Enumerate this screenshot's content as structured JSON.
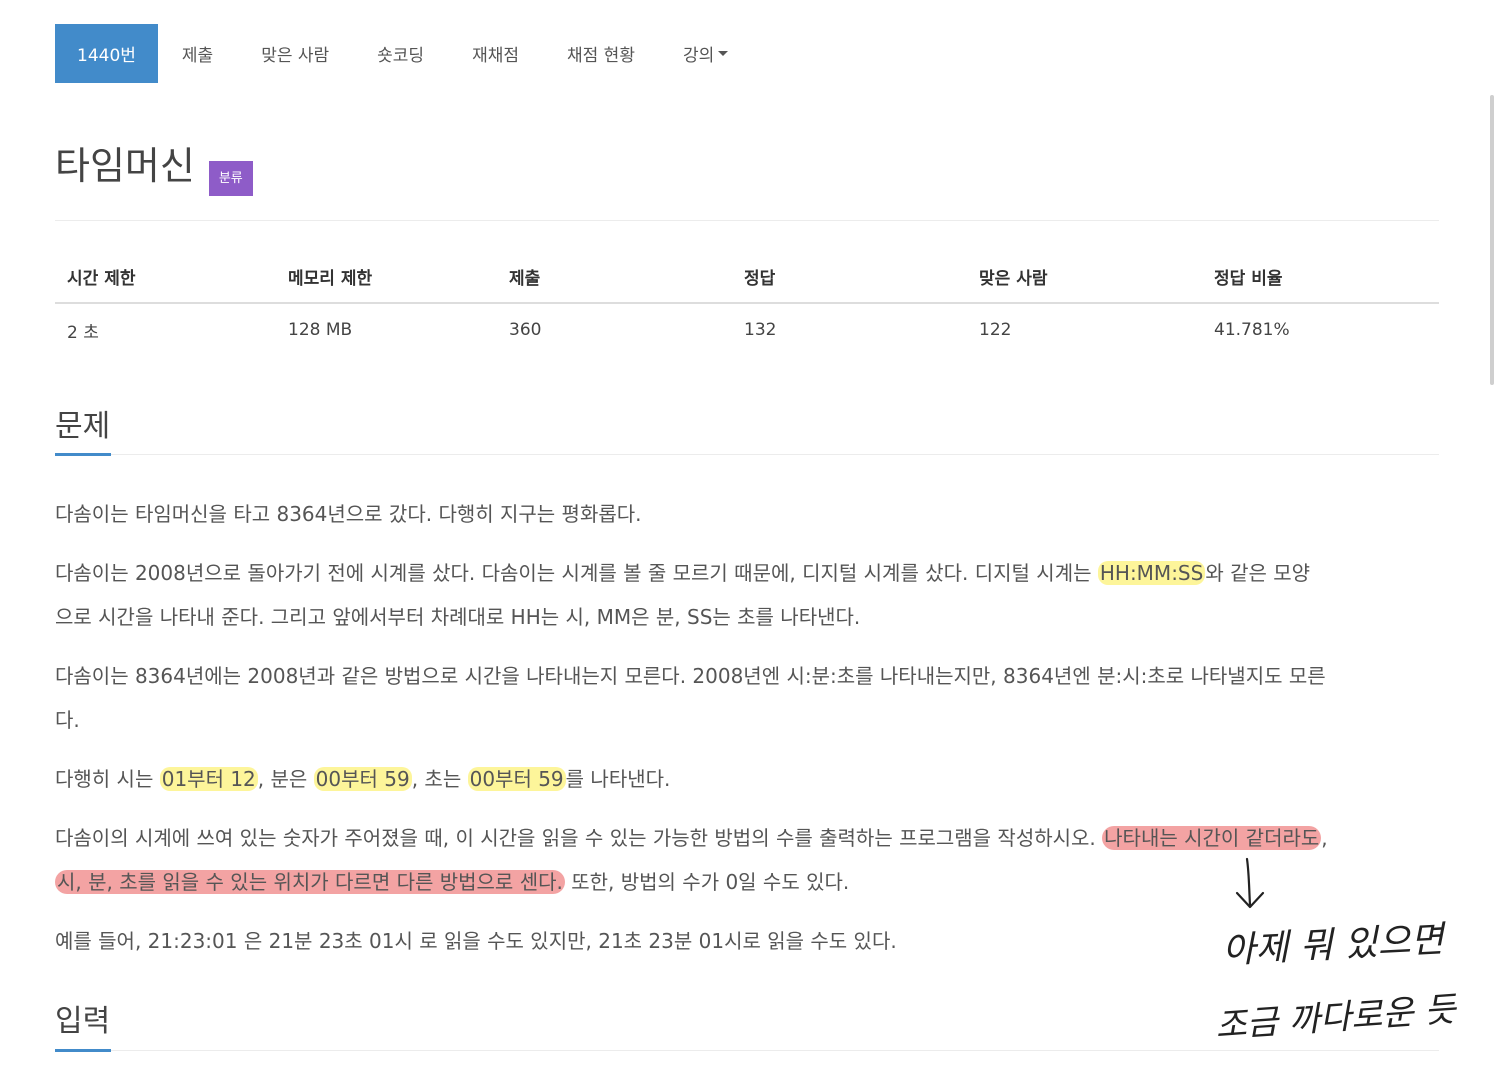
{
  "nav": {
    "items": [
      "1440번",
      "제출",
      "맞은 사람",
      "숏코딩",
      "재채점",
      "채점 현황",
      "강의"
    ]
  },
  "problem": {
    "title": "타임머신",
    "badge": "분류"
  },
  "stats": {
    "headers": [
      "시간 제한",
      "메모리 제한",
      "제출",
      "정답",
      "맞은 사람",
      "정답 비율"
    ],
    "values": [
      "2 초",
      "128 MB",
      "360",
      "132",
      "122",
      "41.781%"
    ]
  },
  "sections": {
    "problem": "문제",
    "input": "입력"
  },
  "desc": {
    "p1": "다솜이는 타임머신을 타고 8364년으로 갔다. 다행히 지구는 평화롭다.",
    "p2a": "다솜이는 2008년으로 돌아가기 전에 시계를 샀다. 다솜이는 시계를 볼 줄 모르기 때문에, 디지털 시계를 샀다. 디지털 시계는 ",
    "p2hl": "HH:MM:SS",
    "p2b": "와 같은 모양",
    "p2c": "으로 시간을 나타내 준다. 그리고 앞에서부터 차례대로 HH는 시, MM은 분, SS는 초를 나타낸다.",
    "p3a": "다솜이는 8364년에는 2008년과 같은 방법으로 시간을 나타내는지 모른다. 2008년엔 시:분:초를 나타내는지만, 8364년엔 분:시:초로 나타낼지도 모른",
    "p3b": "다.",
    "p4a": "다행히 시는 ",
    "p4hl1": "01부터 12",
    "p4b": ", 분은 ",
    "p4hl2": "00부터 59",
    "p4c": ", 초는 ",
    "p4hl3": "00부터 59",
    "p4d": "를 나타낸다.",
    "p5a": "다솜이의 시계에 쓰여 있는 숫자가 주어졌을 때, 이 시간을 읽을 수 있는 가능한 방법의 수를 출력하는 프로그램을 작성하시오. ",
    "p5hl1": "나타내는 시간이 같더라도",
    "p5b": ",",
    "p5hl2": "시, 분, 초를 읽을 수 있는 위치가 다르면 다른 방법으로 센다.",
    "p5c": " 또한, 방법의 수가 0일 수도 있다.",
    "p6": "예를 들어, 21:23:01 은 21분 23초 01시 로 읽을 수도 있지만, 21초 23분 01시로 읽을 수도 있다."
  },
  "annotation": {
    "line1": "아제 뭐 있으면",
    "line2": "조금 까다로운 듯"
  }
}
